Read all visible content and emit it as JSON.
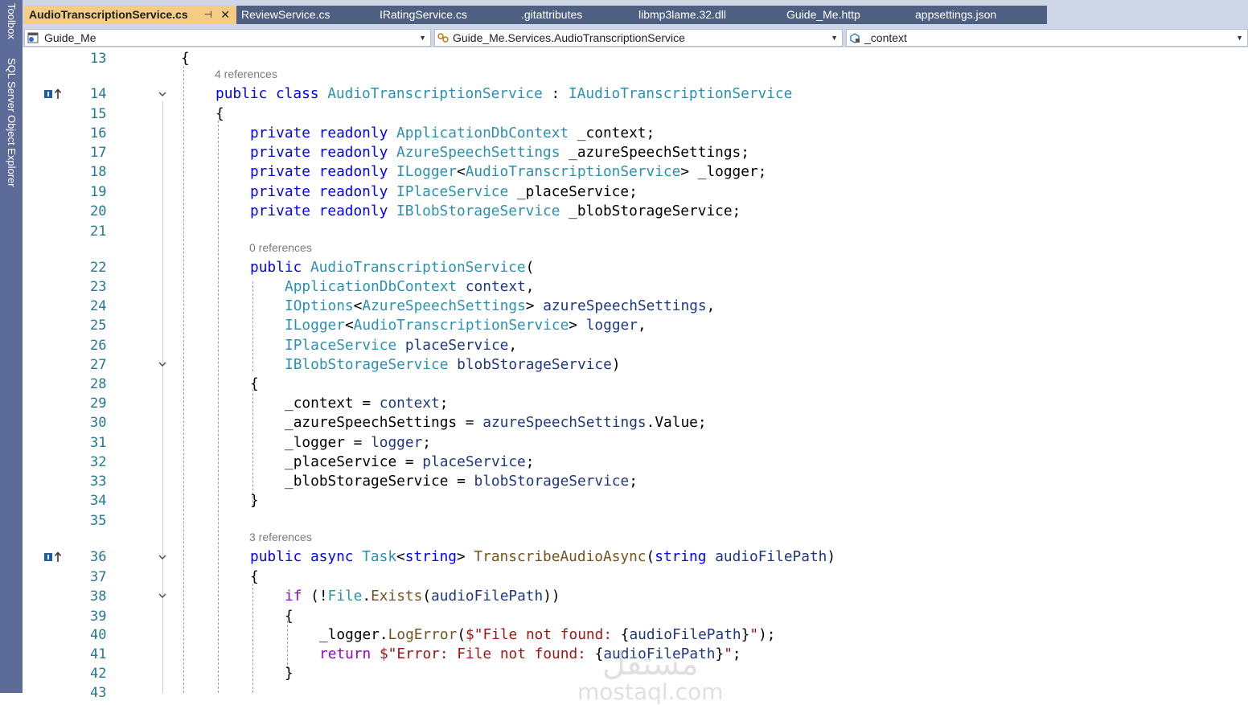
{
  "sidebar": {
    "items": [
      {
        "label": "Toolbox"
      },
      {
        "label": "SQL Server Object Explorer"
      }
    ]
  },
  "tabs": [
    {
      "label": "AudioTranscriptionService.cs",
      "active": true
    },
    {
      "label": "ReviewService.cs",
      "active": false
    },
    {
      "label": "IRatingService.cs",
      "active": false
    },
    {
      "label": ".gitattributes",
      "active": false
    },
    {
      "label": "libmp3lame.32.dll",
      "active": false
    },
    {
      "label": "Guide_Me.http",
      "active": false
    },
    {
      "label": "appsettings.json",
      "active": false
    }
  ],
  "tab_icons": {
    "pin": "pin-icon",
    "close": "close-icon"
  },
  "navbar": {
    "project": "Guide_Me",
    "class": "Guide_Me.Services.AudioTranscriptionService",
    "member": "_context"
  },
  "code": {
    "ref_labels": [
      "4 references",
      "0 references",
      "3 references"
    ],
    "lines": [
      {
        "no": "13",
        "spans": [
          {
            "t": "{",
            "c": "pl"
          }
        ]
      },
      {
        "no": "14",
        "spans": [
          {
            "t": "public",
            "c": "kw"
          },
          {
            "t": " ",
            "c": "pl"
          },
          {
            "t": "class",
            "c": "kw"
          },
          {
            "t": " ",
            "c": "pl"
          },
          {
            "t": "AudioTranscriptionService",
            "c": "ty"
          },
          {
            "t": " : ",
            "c": "pl"
          },
          {
            "t": "IAudioTranscriptionService",
            "c": "ty"
          }
        ]
      },
      {
        "no": "15",
        "spans": [
          {
            "t": "{",
            "c": "pl"
          }
        ]
      },
      {
        "no": "16",
        "spans": [
          {
            "t": "private",
            "c": "kw"
          },
          {
            "t": " ",
            "c": "pl"
          },
          {
            "t": "readonly",
            "c": "kw"
          },
          {
            "t": " ",
            "c": "pl"
          },
          {
            "t": "ApplicationDbContext",
            "c": "ty"
          },
          {
            "t": " _context;",
            "c": "pl"
          }
        ]
      },
      {
        "no": "17",
        "spans": [
          {
            "t": "private",
            "c": "kw"
          },
          {
            "t": " ",
            "c": "pl"
          },
          {
            "t": "readonly",
            "c": "kw"
          },
          {
            "t": " ",
            "c": "pl"
          },
          {
            "t": "AzureSpeechSettings",
            "c": "ty"
          },
          {
            "t": " _azureSpeechSettings;",
            "c": "pl"
          }
        ]
      },
      {
        "no": "18",
        "spans": [
          {
            "t": "private",
            "c": "kw"
          },
          {
            "t": " ",
            "c": "pl"
          },
          {
            "t": "readonly",
            "c": "kw"
          },
          {
            "t": " ",
            "c": "pl"
          },
          {
            "t": "ILogger",
            "c": "ty"
          },
          {
            "t": "<",
            "c": "pl"
          },
          {
            "t": "AudioTranscriptionService",
            "c": "ty"
          },
          {
            "t": "> _logger;",
            "c": "pl"
          }
        ]
      },
      {
        "no": "19",
        "spans": [
          {
            "t": "private",
            "c": "kw"
          },
          {
            "t": " ",
            "c": "pl"
          },
          {
            "t": "readonly",
            "c": "kw"
          },
          {
            "t": " ",
            "c": "pl"
          },
          {
            "t": "IPlaceService",
            "c": "ty"
          },
          {
            "t": " _placeService;",
            "c": "pl"
          }
        ]
      },
      {
        "no": "20",
        "spans": [
          {
            "t": "private",
            "c": "kw"
          },
          {
            "t": " ",
            "c": "pl"
          },
          {
            "t": "readonly",
            "c": "kw"
          },
          {
            "t": " ",
            "c": "pl"
          },
          {
            "t": "IBlobStorageService",
            "c": "ty"
          },
          {
            "t": " _blobStorageService;",
            "c": "pl"
          }
        ]
      },
      {
        "no": "21",
        "spans": []
      },
      {
        "no": "22",
        "spans": [
          {
            "t": "public",
            "c": "kw"
          },
          {
            "t": " ",
            "c": "pl"
          },
          {
            "t": "AudioTranscriptionService",
            "c": "ty"
          },
          {
            "t": "(",
            "c": "pl"
          }
        ]
      },
      {
        "no": "23",
        "spans": [
          {
            "t": "ApplicationDbContext",
            "c": "ty"
          },
          {
            "t": " ",
            "c": "pl"
          },
          {
            "t": "context",
            "c": "pm"
          },
          {
            "t": ",",
            "c": "pl"
          }
        ]
      },
      {
        "no": "24",
        "spans": [
          {
            "t": "IOptions",
            "c": "ty"
          },
          {
            "t": "<",
            "c": "pl"
          },
          {
            "t": "AzureSpeechSettings",
            "c": "ty"
          },
          {
            "t": "> ",
            "c": "pl"
          },
          {
            "t": "azureSpeechSettings",
            "c": "pm"
          },
          {
            "t": ",",
            "c": "pl"
          }
        ]
      },
      {
        "no": "25",
        "spans": [
          {
            "t": "ILogger",
            "c": "ty"
          },
          {
            "t": "<",
            "c": "pl"
          },
          {
            "t": "AudioTranscriptionService",
            "c": "ty"
          },
          {
            "t": "> ",
            "c": "pl"
          },
          {
            "t": "logger",
            "c": "pm"
          },
          {
            "t": ",",
            "c": "pl"
          }
        ]
      },
      {
        "no": "26",
        "spans": [
          {
            "t": "IPlaceService",
            "c": "ty"
          },
          {
            "t": " ",
            "c": "pl"
          },
          {
            "t": "placeService",
            "c": "pm"
          },
          {
            "t": ",",
            "c": "pl"
          }
        ]
      },
      {
        "no": "27",
        "spans": [
          {
            "t": "IBlobStorageService",
            "c": "ty"
          },
          {
            "t": " ",
            "c": "pl"
          },
          {
            "t": "blobStorageService",
            "c": "pm"
          },
          {
            "t": ")",
            "c": "pl"
          }
        ]
      },
      {
        "no": "28",
        "spans": [
          {
            "t": "{",
            "c": "pl"
          }
        ]
      },
      {
        "no": "29",
        "spans": [
          {
            "t": "_context = ",
            "c": "pl"
          },
          {
            "t": "context",
            "c": "pm"
          },
          {
            "t": ";",
            "c": "pl"
          }
        ]
      },
      {
        "no": "30",
        "spans": [
          {
            "t": "_azureSpeechSettings = ",
            "c": "pl"
          },
          {
            "t": "azureSpeechSettings",
            "c": "pm"
          },
          {
            "t": ".Value;",
            "c": "pl"
          }
        ]
      },
      {
        "no": "31",
        "spans": [
          {
            "t": "_logger = ",
            "c": "pl"
          },
          {
            "t": "logger",
            "c": "pm"
          },
          {
            "t": ";",
            "c": "pl"
          }
        ]
      },
      {
        "no": "32",
        "spans": [
          {
            "t": "_placeService = ",
            "c": "pl"
          },
          {
            "t": "placeService",
            "c": "pm"
          },
          {
            "t": ";",
            "c": "pl"
          }
        ]
      },
      {
        "no": "33",
        "spans": [
          {
            "t": "_blobStorageService = ",
            "c": "pl"
          },
          {
            "t": "blobStorageService",
            "c": "pm"
          },
          {
            "t": ";",
            "c": "pl"
          }
        ]
      },
      {
        "no": "34",
        "spans": [
          {
            "t": "}",
            "c": "pl"
          }
        ]
      },
      {
        "no": "35",
        "spans": []
      },
      {
        "no": "36",
        "spans": [
          {
            "t": "public",
            "c": "kw"
          },
          {
            "t": " ",
            "c": "pl"
          },
          {
            "t": "async",
            "c": "kw"
          },
          {
            "t": " ",
            "c": "pl"
          },
          {
            "t": "Task",
            "c": "ty"
          },
          {
            "t": "<",
            "c": "pl"
          },
          {
            "t": "string",
            "c": "kw"
          },
          {
            "t": "> ",
            "c": "pl"
          },
          {
            "t": "TranscribeAudioAsync",
            "c": "fn"
          },
          {
            "t": "(",
            "c": "pl"
          },
          {
            "t": "string",
            "c": "kw"
          },
          {
            "t": " ",
            "c": "pl"
          },
          {
            "t": "audioFilePath",
            "c": "pm"
          },
          {
            "t": ")",
            "c": "pl"
          }
        ]
      },
      {
        "no": "37",
        "spans": [
          {
            "t": "{",
            "c": "pl"
          }
        ]
      },
      {
        "no": "38",
        "spans": [
          {
            "t": "if",
            "c": "ct"
          },
          {
            "t": " (!",
            "c": "pl"
          },
          {
            "t": "File",
            "c": "ty"
          },
          {
            "t": ".",
            "c": "pl"
          },
          {
            "t": "Exists",
            "c": "fn"
          },
          {
            "t": "(",
            "c": "pl"
          },
          {
            "t": "audioFilePath",
            "c": "pm"
          },
          {
            "t": "))",
            "c": "pl"
          }
        ]
      },
      {
        "no": "39",
        "spans": [
          {
            "t": "{",
            "c": "pl"
          }
        ]
      },
      {
        "no": "40",
        "spans": [
          {
            "t": "_logger.",
            "c": "pl"
          },
          {
            "t": "LogError",
            "c": "fn"
          },
          {
            "t": "(",
            "c": "pl"
          },
          {
            "t": "$\"File not found: ",
            "c": "st"
          },
          {
            "t": "{",
            "c": "pl"
          },
          {
            "t": "audioFilePath",
            "c": "pm"
          },
          {
            "t": "}",
            "c": "pl"
          },
          {
            "t": "\"",
            "c": "st"
          },
          {
            "t": ");",
            "c": "pl"
          }
        ]
      },
      {
        "no": "41",
        "spans": [
          {
            "t": "return",
            "c": "ct"
          },
          {
            "t": " ",
            "c": "pl"
          },
          {
            "t": "$\"Error: File not found: ",
            "c": "st"
          },
          {
            "t": "{",
            "c": "pl"
          },
          {
            "t": "audioFilePath",
            "c": "pm"
          },
          {
            "t": "}",
            "c": "pl"
          },
          {
            "t": "\"",
            "c": "st"
          },
          {
            "t": ";",
            "c": "pl"
          }
        ]
      },
      {
        "no": "42",
        "spans": [
          {
            "t": "}",
            "c": "pl"
          }
        ]
      },
      {
        "no": "43",
        "spans": []
      }
    ]
  },
  "watermark": {
    "arabic": "مستقل",
    "latin": "mostaql.com"
  },
  "colors": {
    "keyword": "#0000ff",
    "type": "#2b91af",
    "parameter": "#1f377f",
    "method": "#74531f",
    "string": "#a31515",
    "control": "#8f08c4",
    "line_number": "#237893",
    "sidebar": "#5d6b99",
    "tab_active": "#f5cc84",
    "tab_inactive": "#4d6082"
  }
}
